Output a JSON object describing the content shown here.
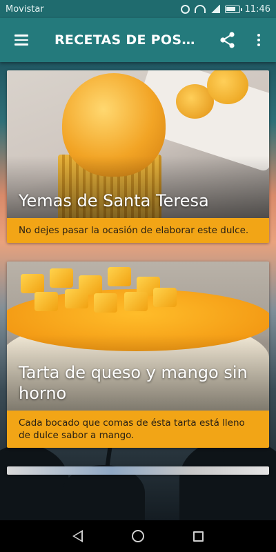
{
  "status_bar": {
    "carrier": "Movistar",
    "time": "11:46"
  },
  "app_bar": {
    "title": "RECETAS DE POST…"
  },
  "recipes": [
    {
      "title": "Yemas de Santa Teresa",
      "description": "No dejes pasar la ocasión de elaborar este dulce."
    },
    {
      "title": "Tarta de queso y mango sin horno",
      "description": "Cada bocado que comas de ésta tarta está lleno de dulce sabor a mango."
    }
  ],
  "colors": {
    "status_bar": "#1f6b6e",
    "app_bar": "#247a7c",
    "description_band": "#f2a516",
    "nav_bar": "#000000"
  },
  "icons": {
    "menu": "hamburger-menu-icon",
    "share": "share-icon",
    "more": "more-vert-icon",
    "alarm": "alarm-icon",
    "wifi": "wifi-icon",
    "signal": "cell-signal-icon",
    "battery": "battery-icon",
    "nav_back": "back-triangle-icon",
    "nav_home": "home-circle-icon",
    "nav_recent": "recents-square-icon"
  }
}
